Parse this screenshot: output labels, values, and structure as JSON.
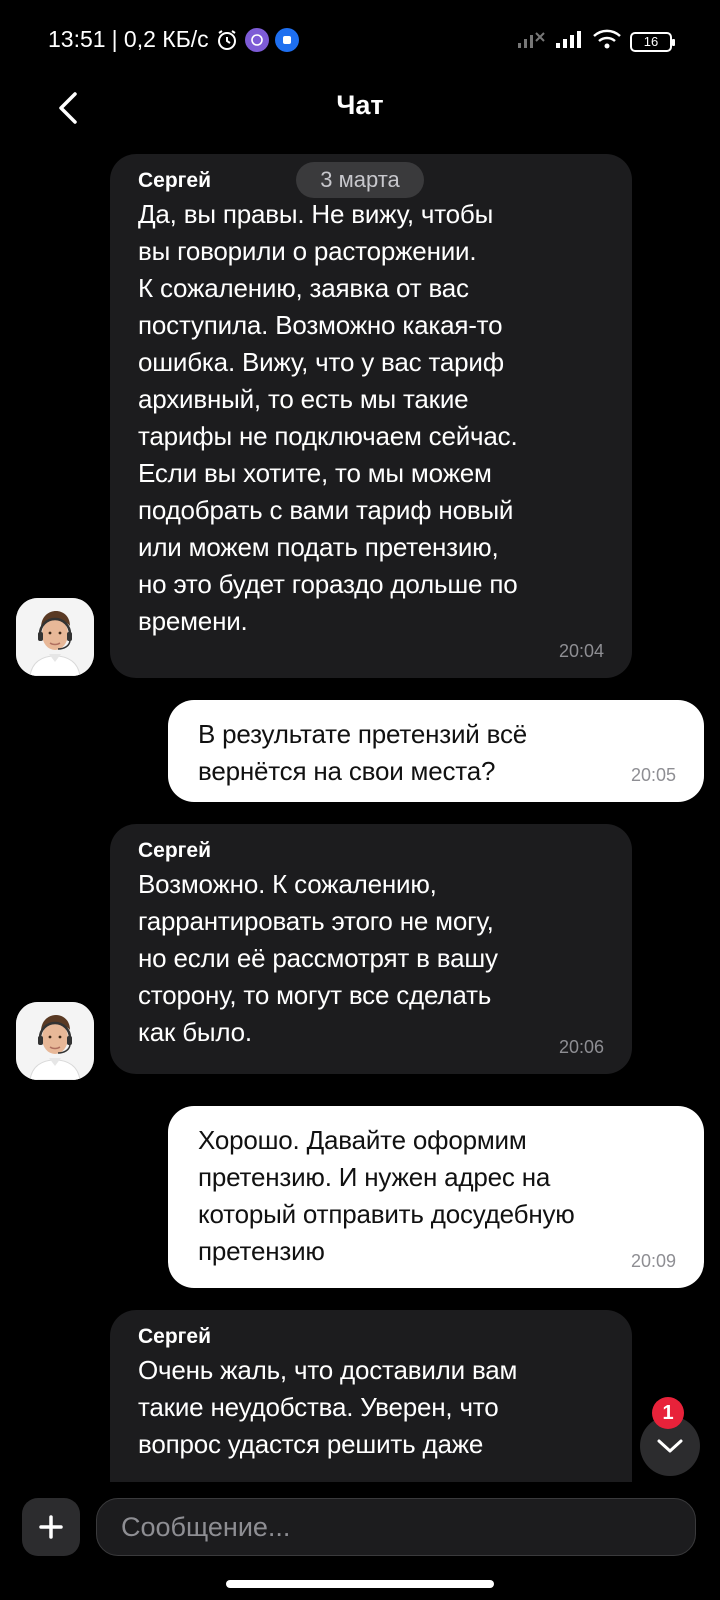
{
  "status_bar": {
    "time": "13:51",
    "net_speed": "| 0,2 КБ/с",
    "battery": "16"
  },
  "header": {
    "title": "Чат"
  },
  "chat": {
    "date_separator": "3 марта",
    "messages": [
      {
        "direction": "in",
        "sender": "Сергей",
        "text": "Да, вы правы. Не вижу, чтобы\nвы говорили о расторжении.\nК сожалению, заявка от вас\nпоступила. Возможно какая-то\nошибка. Вижу, что у вас тариф\nархивный, то есть мы такие\nтарифы не подключаем сейчас.\nЕсли вы хотите, то мы можем\nподобрать с вами тариф новый\nили можем подать претензию,\nно это будет гораздо дольше по\nвремени.",
        "time": "20:04"
      },
      {
        "direction": "out",
        "text": "В результате претензий всё\nвернётся на свои места?",
        "time": "20:05"
      },
      {
        "direction": "in",
        "sender": "Сергей",
        "text": "Возможно. К сожалению,\nгаррантировать этого не могу,\nно если её рассмотрят в вашу\nсторону, то могут все сделать\nкак было.",
        "time": "20:06"
      },
      {
        "direction": "out",
        "text": "Хорошо. Давайте оформим\nпретензию. И нужен адрес на\nкоторый отправить досудебную\nпретензию",
        "time": "20:09"
      },
      {
        "direction": "in",
        "sender": "Сергей",
        "text": "Очень жаль, что доставили вам\nтакие неудобства. Уверен, что\nвопрос удастся решить даже"
      }
    ]
  },
  "scroll_button": {
    "unread_count": "1"
  },
  "composer": {
    "placeholder": "Сообщение..."
  },
  "colors": {
    "background": "#000000",
    "incoming_bubble": "#1c1c1e",
    "outgoing_bubble": "#ffffff",
    "badge": "#e8223a"
  },
  "icons": [
    "back-chevron-icon",
    "chevron-down-icon",
    "plus-icon",
    "wifi-icon",
    "signal-icon",
    "battery-icon",
    "alarm-icon",
    "viber-icon",
    "app-icon"
  ]
}
